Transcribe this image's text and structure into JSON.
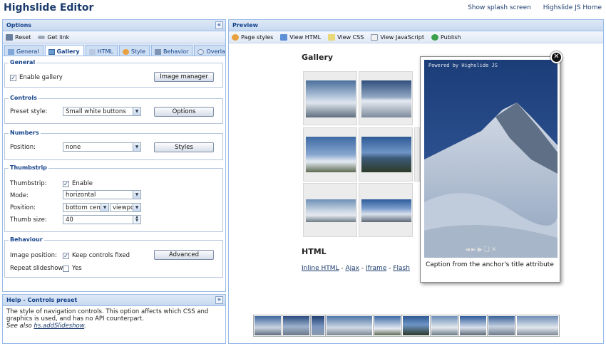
{
  "app": {
    "title": "Highslide Editor"
  },
  "header_links": {
    "splash": "Show splash screen",
    "home": "Highslide JS Home"
  },
  "options": {
    "title": "Options",
    "collapse": "«",
    "toolbar": {
      "reset": "Reset",
      "get_link": "Get link"
    },
    "tabs": [
      "General",
      "Gallery",
      "HTML",
      "Style",
      "Behavior",
      "Overlays"
    ],
    "general": {
      "legend": "General",
      "enable_gallery_label": "Enable gallery",
      "enable_gallery_checked": "✓",
      "image_manager_btn": "Image manager"
    },
    "controls": {
      "legend": "Controls",
      "preset_label": "Preset style:",
      "preset_value": "Small white buttons",
      "options_btn": "Options"
    },
    "numbers": {
      "legend": "Numbers",
      "position_label": "Position:",
      "position_value": "none",
      "styles_btn": "Styles"
    },
    "thumbstrip": {
      "legend": "Thumbstrip",
      "thumbstrip_label": "Thumbstrip:",
      "enable_label": "Enable",
      "enable_checked": "✓",
      "mode_label": "Mode:",
      "mode_value": "horizontal",
      "position_label": "Position:",
      "position_value1": "bottom cent",
      "position_value2": "viewpo",
      "thumb_size_label": "Thumb size:",
      "thumb_size_value": "40"
    },
    "behaviour": {
      "legend": "Behaviour",
      "image_position_label": "Image position:",
      "keep_controls_label": "Keep controls fixed",
      "keep_controls_checked": "✓",
      "advanced_btn": "Advanced",
      "repeat_label": "Repeat slideshow:",
      "yes_label": "Yes"
    }
  },
  "help": {
    "title": "Help - Controls preset",
    "collapse": "»",
    "text": "The style of navigation controls. This option affects which CSS and graphics is used, and has no API counterpart.",
    "see_also": "See also ",
    "link": "hs.addSlideshow",
    "period": "."
  },
  "preview": {
    "title": "Preview",
    "toolbar": {
      "page_styles": "Page styles",
      "view_html": "View HTML",
      "view_css": "View CSS",
      "view_js": "View JavaScript",
      "publish": "Publish"
    },
    "gallery_title": "Gallery",
    "html_title": "HTML",
    "links": {
      "inline": "Inline HTML",
      "ajax": "Ajax",
      "iframe": "Iframe",
      "flash": "Flash",
      "sep": " - "
    },
    "popup": {
      "powered": "Powered by Highslide JS",
      "caption": "Caption from the anchor's title attribute",
      "close": "✕",
      "controls": "◄►▶❑✕"
    }
  },
  "colors": {
    "accent": "#15428b",
    "panel_border": "#99bbe8",
    "link": "#1a3b6b"
  }
}
